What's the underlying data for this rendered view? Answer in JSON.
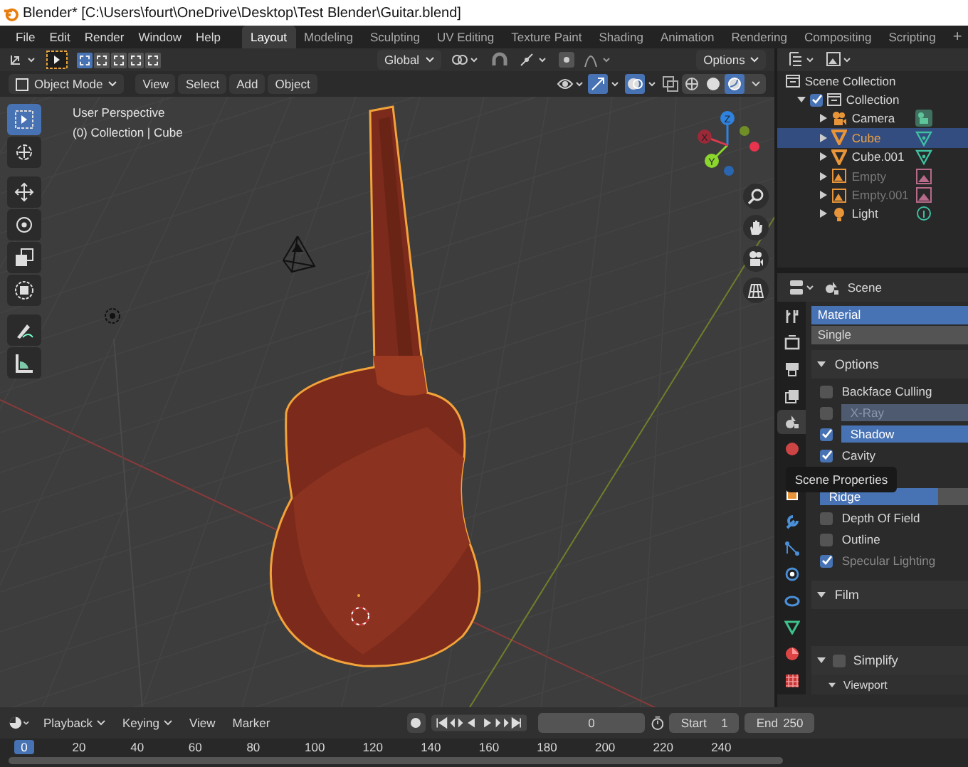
{
  "window": {
    "title": "Blender* [C:\\Users\\fourt\\OneDrive\\Desktop\\Test Blender\\Guitar.blend]"
  },
  "menu": [
    "File",
    "Edit",
    "Render",
    "Window",
    "Help"
  ],
  "workspaces": [
    {
      "label": "Layout",
      "selected": true
    },
    {
      "label": "Modeling",
      "selected": false
    },
    {
      "label": "Sculpting",
      "selected": false
    },
    {
      "label": "UV Editing",
      "selected": false
    },
    {
      "label": "Texture Paint",
      "selected": false
    },
    {
      "label": "Shading",
      "selected": false
    },
    {
      "label": "Animation",
      "selected": false
    },
    {
      "label": "Rendering",
      "selected": false
    },
    {
      "label": "Compositing",
      "selected": false
    },
    {
      "label": "Scripting",
      "selected": false
    }
  ],
  "add_workspace": "+",
  "tool_header": {
    "select_modes": [
      {
        "selected": true
      },
      {
        "selected": false
      },
      {
        "selected": false
      },
      {
        "selected": false
      },
      {
        "selected": false
      }
    ],
    "orientation": "Global",
    "options": "Options"
  },
  "viewport_header": {
    "mode": "Object Mode",
    "menus": [
      "View",
      "Select",
      "Add",
      "Object"
    ],
    "shading": [
      {
        "kind": "wireframe",
        "selected": false
      },
      {
        "kind": "solid",
        "selected": false
      },
      {
        "kind": "material",
        "selected": true
      }
    ]
  },
  "viewport": {
    "view_name": "User Perspective",
    "context": "(0) Collection | Cube",
    "tools": [
      {
        "kind": "select",
        "selected": true
      },
      {
        "kind": "cursor",
        "selected": false
      },
      {
        "kind": "move",
        "selected": false
      },
      {
        "kind": "rotate",
        "selected": false
      },
      {
        "kind": "scale",
        "selected": false
      },
      {
        "kind": "transform",
        "selected": false
      },
      {
        "kind": "annotate",
        "selected": false
      },
      {
        "kind": "measure",
        "selected": false
      }
    ],
    "axes": [
      "X",
      "Y",
      "Z"
    ]
  },
  "outliner": {
    "root": "Scene Collection",
    "children": [
      {
        "name": "Collection",
        "checked": true,
        "expanded": true,
        "children": [
          {
            "name": "Camera",
            "kind": "camera",
            "selected": false,
            "disabled": false
          },
          {
            "name": "Cube",
            "kind": "mesh",
            "selected": true,
            "disabled": false
          },
          {
            "name": "Cube.001",
            "kind": "mesh",
            "selected": false,
            "disabled": false
          },
          {
            "name": "Empty",
            "kind": "image",
            "selected": false,
            "disabled": true
          },
          {
            "name": "Empty.001",
            "kind": "image",
            "selected": false,
            "disabled": true
          },
          {
            "name": "Light",
            "kind": "light",
            "selected": false,
            "disabled": false
          }
        ]
      }
    ]
  },
  "properties": {
    "context": "Scene",
    "tabs": [
      {
        "kind": "tool",
        "selected": false
      },
      {
        "kind": "render",
        "selected": false
      },
      {
        "kind": "output",
        "selected": false
      },
      {
        "kind": "view-layer",
        "selected": false
      },
      {
        "kind": "scene",
        "selected": true
      },
      {
        "kind": "world",
        "selected": false
      },
      {
        "kind": "object",
        "selected": false
      },
      {
        "kind": "modifier",
        "selected": false
      },
      {
        "kind": "particles",
        "selected": false
      },
      {
        "kind": "physics",
        "selected": false
      },
      {
        "kind": "constraint",
        "selected": false
      },
      {
        "kind": "data",
        "selected": false
      },
      {
        "kind": "material",
        "selected": false
      },
      {
        "kind": "texture",
        "selected": false
      }
    ],
    "color_options": [
      {
        "label": "Material",
        "selected": true
      },
      {
        "label": "Single",
        "selected": false
      }
    ],
    "options": {
      "title": "Options",
      "expanded": true,
      "items": [
        {
          "kind": "checkbox",
          "label": "Backface Culling",
          "checked": false,
          "disabled": false
        },
        {
          "kind": "toggle-field",
          "label": "X-Ray",
          "checked": false,
          "disabled": true
        },
        {
          "kind": "toggle-field",
          "label": "Shadow",
          "checked": true,
          "disabled": false
        },
        {
          "kind": "checkbox",
          "label": "Cavity",
          "checked": true,
          "disabled": false
        },
        {
          "kind": "slider",
          "label": "Ridge",
          "level": 0.8
        },
        {
          "kind": "checkbox",
          "label": "Depth Of Field",
          "checked": false,
          "disabled": false
        },
        {
          "kind": "checkbox",
          "label": "Outline",
          "checked": false,
          "disabled": false
        },
        {
          "kind": "checkbox",
          "label": "Specular Lighting",
          "checked": true,
          "disabled": true
        }
      ]
    },
    "film": {
      "title": "Film",
      "expanded": true
    },
    "simplify": {
      "title": "Simplify",
      "checked": false,
      "expanded": true,
      "sub": {
        "title": "Viewport",
        "expanded": true
      }
    },
    "tooltip": "Scene Properties"
  },
  "timeline": {
    "menus": [
      {
        "label": "Playback",
        "kind": "dropdown"
      },
      {
        "label": "Keying",
        "kind": "dropdown"
      },
      {
        "label": "View",
        "kind": "menu"
      },
      {
        "label": "Marker",
        "kind": "menu"
      }
    ],
    "current_frame": "0",
    "start_label": "Start",
    "start": "1",
    "end_label": "End",
    "end": "250",
    "ruler": [
      {
        "label": "0",
        "selected": true
      },
      {
        "label": "20",
        "selected": false
      },
      {
        "label": "40",
        "selected": false
      },
      {
        "label": "60",
        "selected": false
      },
      {
        "label": "80",
        "selected": false
      },
      {
        "label": "100",
        "selected": false
      },
      {
        "label": "120",
        "selected": false
      },
      {
        "label": "140",
        "selected": false
      },
      {
        "label": "160",
        "selected": false
      },
      {
        "label": "180",
        "selected": false
      },
      {
        "label": "200",
        "selected": false
      },
      {
        "label": "220",
        "selected": false
      },
      {
        "label": "240",
        "selected": false
      }
    ]
  }
}
